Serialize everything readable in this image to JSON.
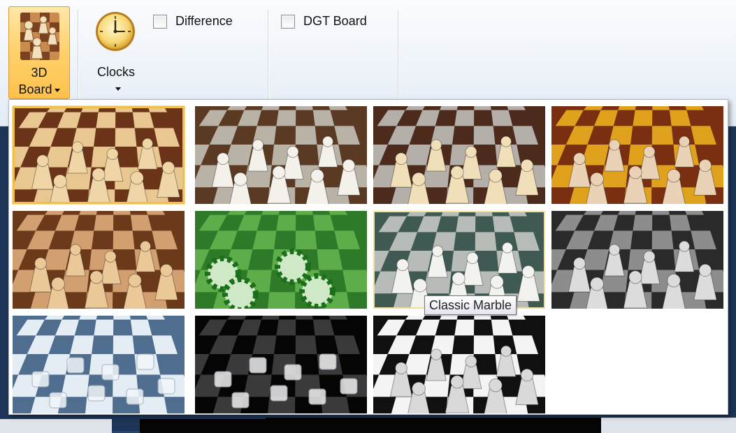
{
  "ribbon": {
    "board_button": {
      "line1": "3D",
      "line2": "Board"
    },
    "clocks_button": {
      "label": "Clocks"
    },
    "difference_checkbox": {
      "label": "Difference",
      "checked": false
    },
    "dgt_checkbox": {
      "label": "DGT Board",
      "checked": false
    }
  },
  "gallery": {
    "selected_index": 0,
    "hovered_index": 6,
    "items": [
      {
        "light": "#e8c890",
        "dark": "#6b3418",
        "piece": "#f0d6a6",
        "style": "wood"
      },
      {
        "light": "#b9b2a6",
        "dark": "#5a3a22",
        "piece": "#f4f1ea",
        "style": "stone"
      },
      {
        "light": "#b4afa8",
        "dark": "#4c2b1d",
        "piece": "#f0dfb8",
        "style": "marble-brown"
      },
      {
        "light": "#e0a21c",
        "dark": "#7a2f10",
        "piece": "#e9d2b6",
        "style": "amber"
      },
      {
        "light": "#d2a070",
        "dark": "#6a3a1a",
        "piece": "#eac898",
        "style": "oak"
      },
      {
        "light": "#5ead4a",
        "dark": "#2f7a28",
        "piece": "#1c6f1a",
        "style": "green-balls"
      },
      {
        "light": "#b7bcb8",
        "dark": "#3f5a52",
        "piece": "#f2f2ee",
        "style": "classic-marble"
      },
      {
        "light": "#8d8d8d",
        "dark": "#2a2a2a",
        "piece": "#dcdcdc",
        "style": "greyscale"
      },
      {
        "light": "#e4ecf4",
        "dark": "#4f6d8e",
        "piece": "#f2f6fa",
        "style": "ice"
      },
      {
        "light": "#3a3a3a",
        "dark": "#050505",
        "piece": "#f0f0f0",
        "style": "glass-dark"
      },
      {
        "light": "#f4f4f4",
        "dark": "#101010",
        "piece": "#d9d9d9",
        "style": "glass-checker"
      }
    ],
    "tooltip": "Classic Marble"
  }
}
